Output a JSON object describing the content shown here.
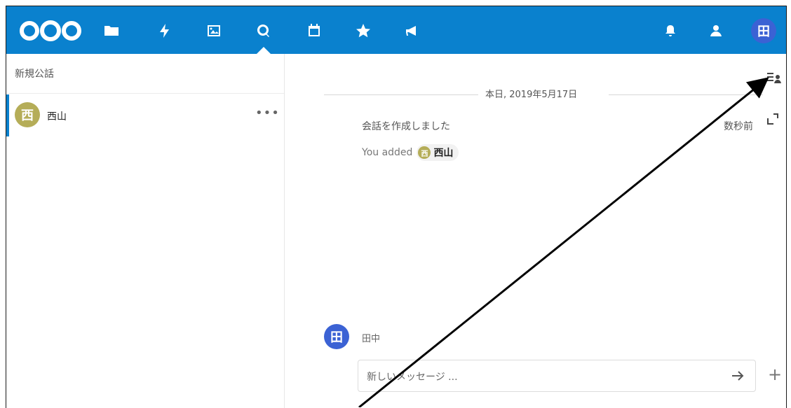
{
  "topbar": {
    "logo_name": "nextcloud-logo",
    "icons": [
      "files-icon",
      "activity-icon",
      "photos-icon",
      "talk-icon",
      "calendar-icon",
      "favorites-icon",
      "announcements-icon",
      "notifications-icon",
      "contacts-icon"
    ],
    "avatar_initial": "田"
  },
  "sidebar": {
    "new_conversation": "新規公話",
    "conversations": [
      {
        "initial": "西",
        "name": "西山",
        "menu": "•••"
      }
    ]
  },
  "chat": {
    "date_separator": "本日, 2019年5月17日",
    "system_message": "会話を作成しました",
    "time_ago": "数秒前",
    "added_prefix": "You added",
    "added_user_initial": "西",
    "added_user_name": "西山",
    "composer_user_initial": "田",
    "composer_user_name": "田中",
    "composer_placeholder": "新しいメッセージ ...",
    "plus_label": "+"
  },
  "colors": {
    "header": "#0a81ce",
    "user_avatar": "#3b62d4",
    "conversation_avatar": "#b5ad58"
  }
}
